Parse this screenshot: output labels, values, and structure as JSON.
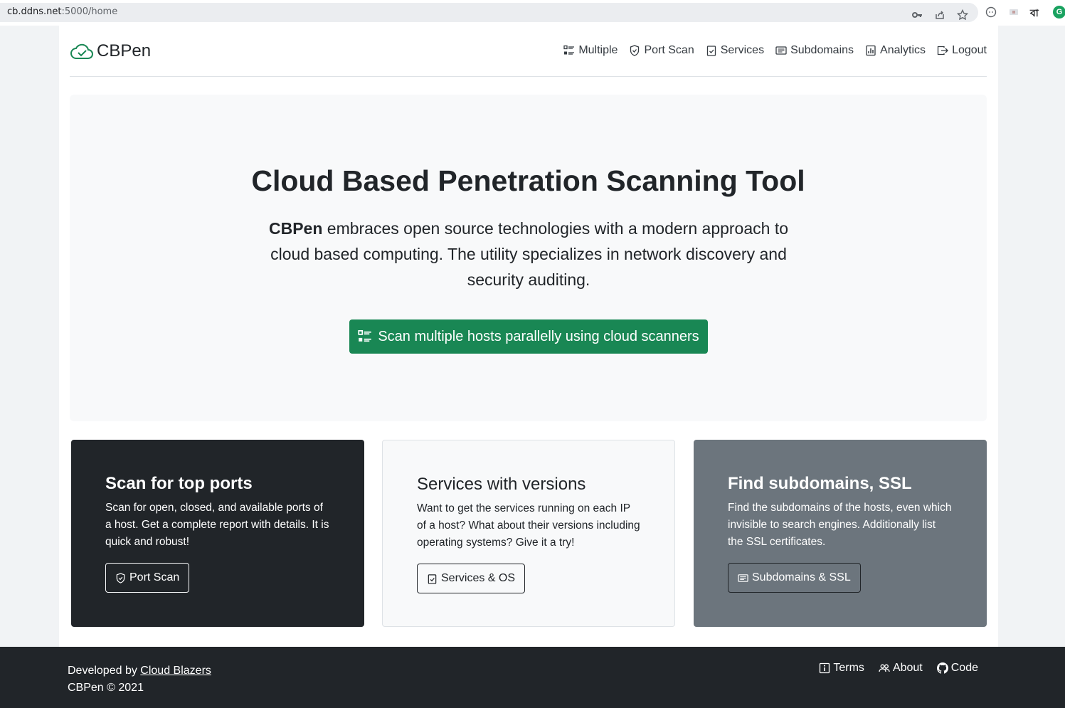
{
  "browser": {
    "url_host": "cb.ddns.net",
    "url_path": ":5000/home",
    "lang_char": "বা",
    "avatar_letter": "G"
  },
  "header": {
    "brand": "CBPen",
    "nav": [
      {
        "label": "Multiple",
        "icon": "list-check-icon"
      },
      {
        "label": "Port Scan",
        "icon": "shield-icon"
      },
      {
        "label": "Services",
        "icon": "clipboard-check-icon"
      },
      {
        "label": "Subdomains",
        "icon": "card-text-icon"
      },
      {
        "label": "Analytics",
        "icon": "bar-chart-icon"
      },
      {
        "label": "Logout",
        "icon": "box-arrow-right-icon"
      }
    ]
  },
  "hero": {
    "title": "Cloud Based Penetration Scanning Tool",
    "lead_bold": "CBPen",
    "lead_rest": " embraces open source technologies with a modern approach to cloud based computing. The utility specializes in network discovery and security auditing.",
    "button": "Scan multiple hosts parallelly using cloud scanners"
  },
  "cards": [
    {
      "title": "Scan for top ports",
      "text": "Scan for open, closed, and available ports of a host. Get a complete report with details. It is quick and robust!",
      "button": "Port Scan"
    },
    {
      "title": "Services with versions",
      "text": "Want to get the services running on each IP of a host? What about their versions including operating systems? Give it a try!",
      "button": "Services & OS"
    },
    {
      "title": "Find subdomains, SSL",
      "text": "Find the subdomains of the hosts, even which invisible to search engines. Additionally list the SSL certificates.",
      "button": "Subdomains & SSL"
    }
  ],
  "footer": {
    "developed_by": "Developed by ",
    "developer": "Cloud Blazers",
    "copyright": "CBPen © 2021",
    "links": [
      "Terms",
      "About",
      "Code"
    ]
  },
  "colors": {
    "success": "#198754",
    "dark": "#212529",
    "secondary": "#6c757d",
    "light": "#f8f9fa"
  }
}
